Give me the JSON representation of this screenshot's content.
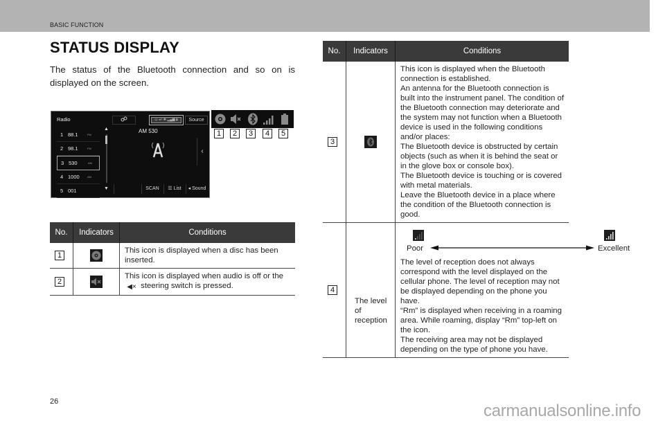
{
  "header": {
    "section": "BASIC FUNCTION"
  },
  "page_title": "STATUS DISPLAY",
  "intro": "The status of the Bluetooth connection and so on is displayed on the screen.",
  "screen": {
    "title": "Radio",
    "source_button": "Source",
    "station": "AM 530",
    "presets": [
      {
        "num": "1",
        "freq": "88.1",
        "band": "FM",
        "active": false
      },
      {
        "num": "2",
        "freq": "98.1",
        "band": "FM",
        "active": false
      },
      {
        "num": "3",
        "freq": "530",
        "band": "AM",
        "active": true
      },
      {
        "num": "4",
        "freq": "1000",
        "band": "AM",
        "active": false
      },
      {
        "num": "5",
        "freq": "001",
        "band": "",
        "active": false
      }
    ],
    "bottom_buttons": {
      "scan": "SCAN",
      "list": "List",
      "sound": "Sound"
    },
    "icons": {
      "setup": "setup-icon",
      "antenna": "antenna-icon",
      "back": "‹",
      "up": "▲",
      "down": "▼"
    }
  },
  "status_icons": [
    {
      "num": "1",
      "icon": "disc-icon"
    },
    {
      "num": "2",
      "icon": "mute-icon"
    },
    {
      "num": "3",
      "icon": "bluetooth-icon"
    },
    {
      "num": "4",
      "icon": "signal-icon"
    },
    {
      "num": "5",
      "icon": "battery-icon"
    }
  ],
  "table": {
    "headers": {
      "no": "No.",
      "indicators": "Indicators",
      "conditions": "Conditions"
    },
    "rows": [
      {
        "no": "1",
        "icon": "disc-icon",
        "indicator_text": "",
        "condition": "This icon is displayed when a disc has been inserted."
      },
      {
        "no": "2",
        "icon": "mute-icon",
        "indicator_text": "",
        "condition_pre": "This icon is displayed when audio is off or the",
        "condition_post": "steering switch is pressed."
      },
      {
        "no": "3",
        "icon": "bluetooth-icon",
        "indicator_text": "",
        "condition_lines": [
          "This icon is displayed when the Bluetooth connection is established.",
          "An antenna for the Bluetooth connection is built into the instrument panel. The condition of the Bluetooth connection may deteriorate and the system may not function when a Bluetooth device is used in the following conditions and/or places:",
          "The Bluetooth device is obstructed by certain objects (such as when it is behind the seat or in the glove box or console box).",
          "The Bluetooth device is touching or is covered with metal materials.",
          "Leave the Bluetooth device in a place where the condition of the Bluetooth connection is good."
        ]
      },
      {
        "no": "4",
        "icon": "",
        "indicator_text": "The level of reception",
        "scale": {
          "poor": "Poor",
          "excellent": "Excellent"
        },
        "condition_lines": [
          "The level of reception does not always correspond with the level displayed on the cellular phone. The level of reception may not be displayed depending on the phone you have.",
          "“Rm” is displayed when receiving in a roaming area. While roaming, display “Rm” top-left on the icon.",
          "The receiving area may not be displayed depending on the type of phone you have."
        ]
      }
    ]
  },
  "footer": {
    "page_number": "26",
    "watermark": "carmanualsonline.info"
  }
}
